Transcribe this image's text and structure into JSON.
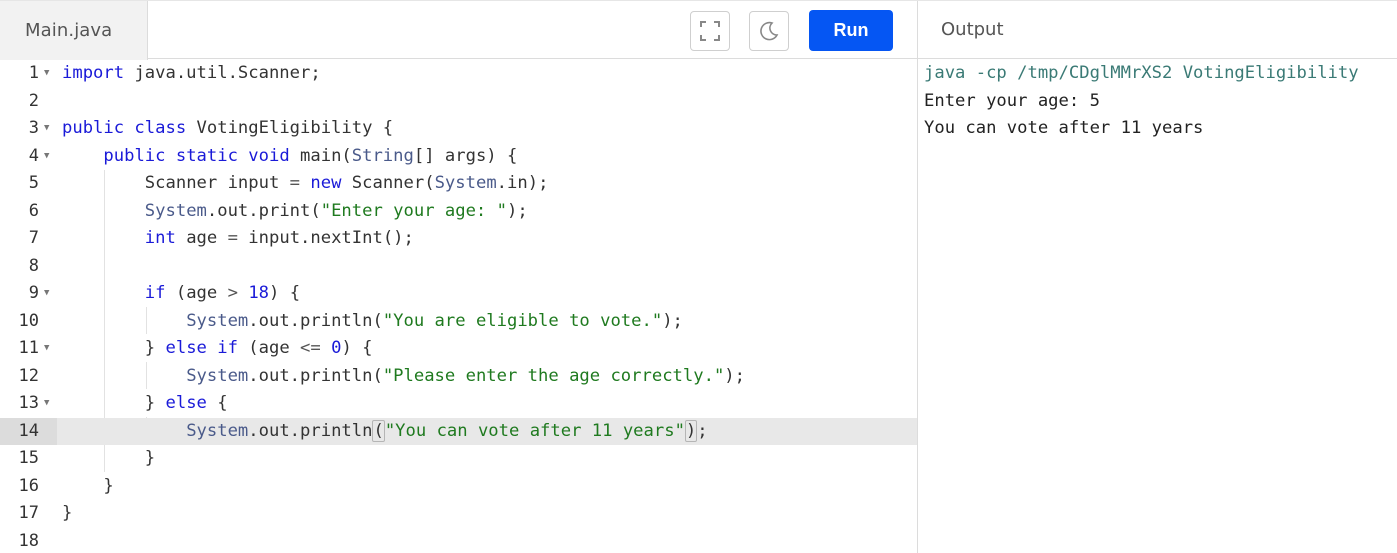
{
  "editor": {
    "file_tab": "Main.java",
    "run_label": "Run",
    "icons": {
      "fullscreen": "fullscreen-icon",
      "theme": "moon-icon"
    },
    "lines": [
      {
        "n": "1",
        "fold": true
      },
      {
        "n": "2",
        "fold": false
      },
      {
        "n": "3",
        "fold": true
      },
      {
        "n": "4",
        "fold": true
      },
      {
        "n": "5",
        "fold": false
      },
      {
        "n": "6",
        "fold": false
      },
      {
        "n": "7",
        "fold": false
      },
      {
        "n": "8",
        "fold": false
      },
      {
        "n": "9",
        "fold": true
      },
      {
        "n": "10",
        "fold": false
      },
      {
        "n": "11",
        "fold": true
      },
      {
        "n": "12",
        "fold": false
      },
      {
        "n": "13",
        "fold": true
      },
      {
        "n": "14",
        "fold": false,
        "active": true
      },
      {
        "n": "15",
        "fold": false
      },
      {
        "n": "16",
        "fold": false
      },
      {
        "n": "17",
        "fold": false
      },
      {
        "n": "18",
        "fold": false
      }
    ],
    "code": {
      "l1_kw": "import",
      "l1_rest": " java.util.Scanner;",
      "l3_kw": "public class",
      "l3_rest": " VotingEligibility {",
      "l4_kw": "public static void",
      "l4_a": " main(",
      "l4_ty": "String",
      "l4_b": "[] args) {",
      "l5_a": "Scanner input ",
      "l5_op": "=",
      "l5_b": " ",
      "l5_kw": "new",
      "l5_c": " Scanner(",
      "l5_ty": "System",
      "l5_d": ".in);",
      "l6_ty": "System",
      "l6_a": ".out.print(",
      "l6_str": "\"Enter your age: \"",
      "l6_b": ");",
      "l7_kw": "int",
      "l7_a": " age ",
      "l7_op": "=",
      "l7_b": " input.nextInt();",
      "l9_kw": "if",
      "l9_a": " (age ",
      "l9_op": ">",
      "l9_b": " ",
      "l9_num": "18",
      "l9_c": ") {",
      "l10_ty": "System",
      "l10_a": ".out.println(",
      "l10_str": "\"You are eligible to vote.\"",
      "l10_b": ");",
      "l11_a": "} ",
      "l11_kw": "else if",
      "l11_b": " (age ",
      "l11_op": "<=",
      "l11_c": " ",
      "l11_num": "0",
      "l11_d": ") {",
      "l12_ty": "System",
      "l12_a": ".out.println(",
      "l12_str": "\"Please enter the age correctly.\"",
      "l12_b": ");",
      "l13_a": "} ",
      "l13_kw": "else",
      "l13_b": " {",
      "l14_ty": "System",
      "l14_a": ".out.println",
      "l14_p1": "(",
      "l14_str": "\"You can vote after 11 years\"",
      "l14_p2": ")",
      "l14_b": ";",
      "l15": "}",
      "l16": "}",
      "l17": "}"
    }
  },
  "output": {
    "header": "Output",
    "command": "java -cp /tmp/CDglMMrXS2 VotingEligibility",
    "lines": [
      "Enter your age: 5",
      "You can vote after 11 years"
    ]
  },
  "colors": {
    "run_button": "#0556f3",
    "keyword": "#1a1ad8",
    "string": "#1f7a1f",
    "type": "#4a5a8a",
    "command": "#3a7a75"
  }
}
